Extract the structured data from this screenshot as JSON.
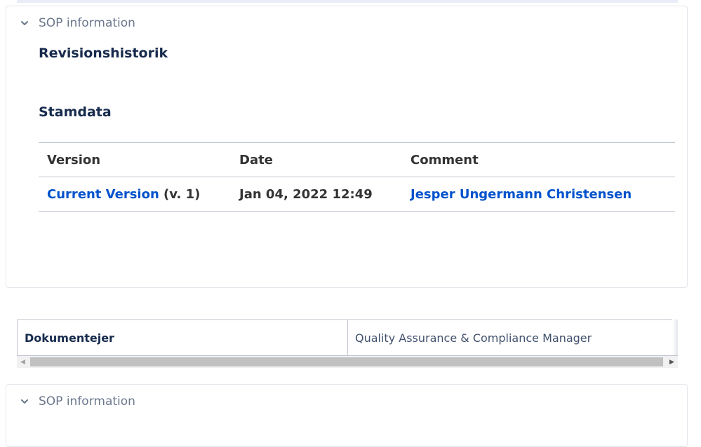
{
  "panel_top": {
    "expand_label": "SOP information",
    "heading_revision": "Revisionshistorik",
    "heading_stamdata": "Stamdata",
    "table": {
      "headers": {
        "version": "Version",
        "date": "Date",
        "comment": "Comment"
      },
      "rows": [
        {
          "version_link": "Current Version",
          "version_suffix": " (v. 1)",
          "date": "Jan 04, 2022 12:49",
          "author": "Jesper Ungermann Christensen"
        }
      ]
    }
  },
  "metadata": {
    "key": "Dokumentejer",
    "value": "Quality Assurance & Compliance Manager"
  },
  "panel_bottom": {
    "expand_label": "SOP information"
  },
  "icons": {
    "expand": "chevron-down-icon",
    "scroll_left": "scroll-left-arrow-icon",
    "scroll_right": "scroll-right-arrow-icon"
  },
  "colors": {
    "link": "#0052cc",
    "heading": "#172b4d",
    "muted": "#6b778c"
  }
}
